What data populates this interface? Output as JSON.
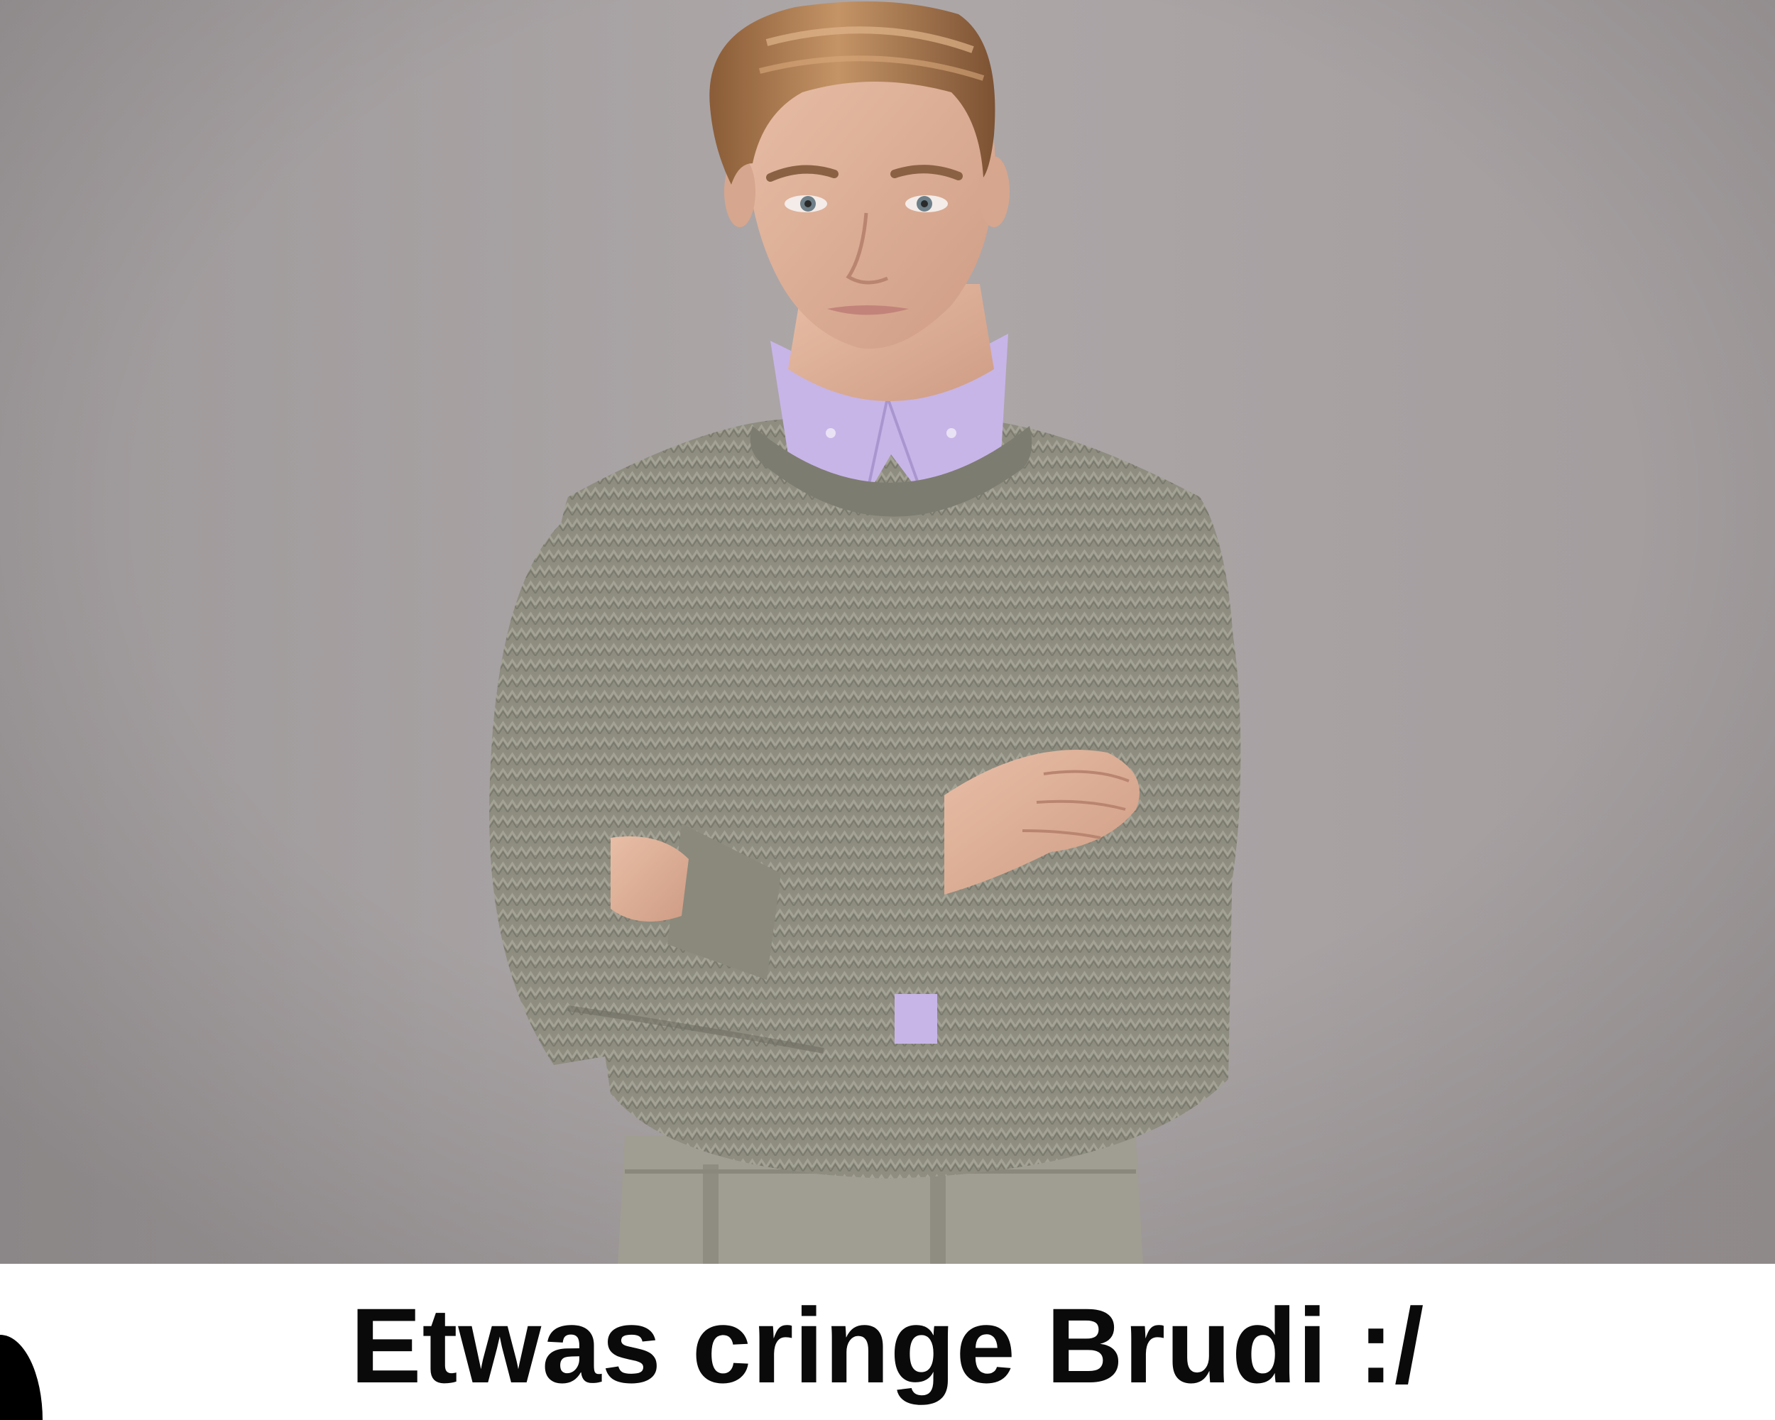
{
  "caption": {
    "text": "Etwas cringe Brudi :/"
  },
  "colors": {
    "backdrop": "#a8a2a3",
    "sweater": "#8e8d80",
    "shirt": "#c7b5e8",
    "skin": "#dfb29b",
    "hair": "#a8764d",
    "trousers": "#a09d93",
    "caption_text": "#0a0a0a",
    "caption_bar": "#ffffff"
  }
}
